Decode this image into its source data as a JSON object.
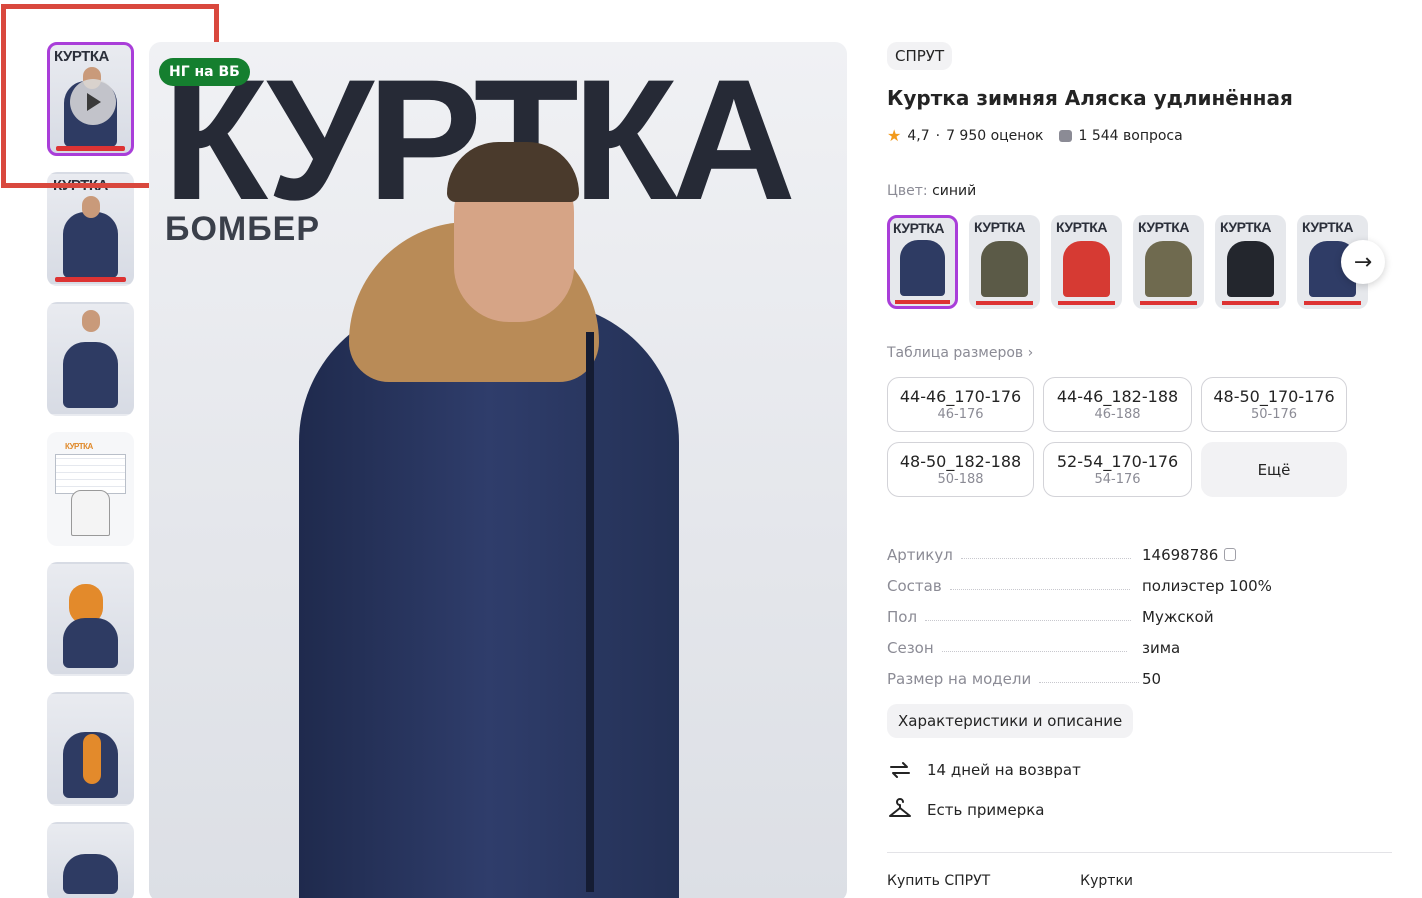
{
  "thumbnails": [
    {
      "title": "КУРТКА",
      "kind": "video"
    },
    {
      "title": "КУРТКА",
      "kind": "photo"
    },
    {
      "title": "",
      "kind": "photo"
    },
    {
      "title": "КУРТКА",
      "kind": "size-chart"
    },
    {
      "title": "",
      "kind": "hood"
    },
    {
      "title": "",
      "kind": "lining"
    },
    {
      "title": "",
      "kind": "photo"
    }
  ],
  "main_image": {
    "headline": "КУРТКА",
    "subheadline": "БОМБЕР",
    "badge": "НГ на ВБ"
  },
  "product": {
    "brand": "СПРУТ",
    "title": "Куртка зимняя Аляска удлинённая",
    "rating": "4,7",
    "reviews": "7 950 оценок",
    "questions": "1 544 вопроса",
    "color_label": "Цвет:",
    "color_value": "синий"
  },
  "swatches": [
    {
      "title": "КУРТКА",
      "color": "#2e3b63"
    },
    {
      "title": "КУРТКА",
      "color": "#5b5a47"
    },
    {
      "title": "КУРТКА",
      "color": "#d63a33"
    },
    {
      "title": "КУРТКА",
      "color": "#6f6a4f"
    },
    {
      "title": "КУРТКА",
      "color": "#23262d"
    },
    {
      "title": "КУРТКА",
      "color": "#2f3c66"
    }
  ],
  "size_table_label": "Таблица размеров ›",
  "sizes": [
    {
      "main": "44-46_170-176",
      "sub": "46-176"
    },
    {
      "main": "44-46_182-188",
      "sub": "46-188"
    },
    {
      "main": "48-50_170-176",
      "sub": "50-176"
    },
    {
      "main": "48-50_182-188",
      "sub": "50-188"
    },
    {
      "main": "52-54_170-176",
      "sub": "54-176"
    }
  ],
  "more_sizes": "Ещё",
  "specs": [
    {
      "key": "Артикул",
      "value": "14698786"
    },
    {
      "key": "Состав",
      "value": "полиэстер 100%"
    },
    {
      "key": "Пол",
      "value": "Мужской"
    },
    {
      "key": "Сезон",
      "value": "зима"
    },
    {
      "key": "Размер на модели",
      "value": "50"
    }
  ],
  "chars_button": "Характеристики и описание",
  "features": {
    "return": "14 дней на возврат",
    "fitting": "Есть примерка"
  },
  "bottom": {
    "left": "Купить СПРУТ",
    "right": "Куртки"
  }
}
